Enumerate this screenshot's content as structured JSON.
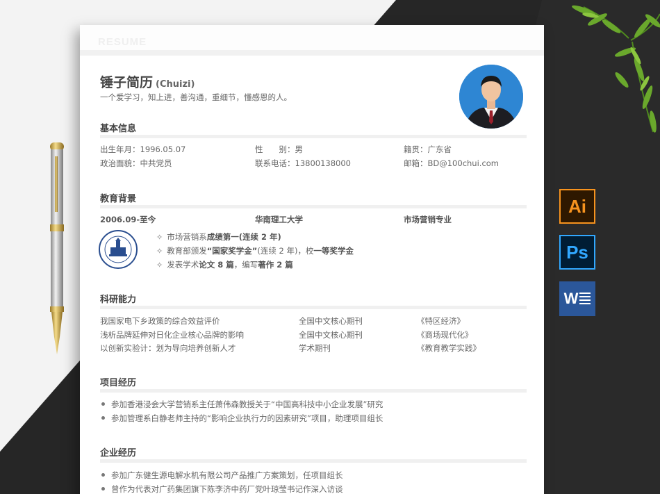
{
  "resume": {
    "watermark": "RESUME",
    "name": "锤子简历",
    "name_en": "(Chuizi)",
    "motto": "一个爱学习，知上进，善沟通，重细节，懂感恩的人。"
  },
  "basic": {
    "title": "基本信息",
    "birth": "出生年月：1996.05.07",
    "gender_label": "性　　别：",
    "gender_value": "男",
    "hometown": "籍贯：广东省",
    "political": "政治面貌：中共党员",
    "phone": "联系电话：13800138000",
    "email": "邮箱：BD@100chui.com"
  },
  "education": {
    "title": "教育背景",
    "period": "2006.09-至今",
    "school": "华南理工大学",
    "major": "市场营销专业",
    "items": [
      {
        "a": "市场营销系",
        "b": "成绩第一(连续 2 年)",
        "c": "",
        "d": "",
        "e": ""
      },
      {
        "a": "教育部颁发",
        "b": "“国家奖学金”",
        "c": "(连续 2 年)，校",
        "d": "一等奖学金",
        "e": ""
      },
      {
        "a": "发表学术",
        "b": "论文 8 篇",
        "c": "，编写",
        "d": "著作 2 篇",
        "e": ""
      }
    ]
  },
  "research": {
    "title": "科研能力",
    "rows": [
      {
        "topic": "我国家电下乡政策的综合效益评价",
        "level": "全国中文核心期刊",
        "journal": "《特区经济》"
      },
      {
        "topic": "浅析品牌延伸对日化企业核心品牌的影响",
        "level": "全国中文核心期刊",
        "journal": "《商场现代化》"
      },
      {
        "topic": "以创新实验计：划为导向培养创新人才",
        "level": "学术期刊",
        "journal": "《教育教学实践》"
      }
    ]
  },
  "projects": {
    "title": "项目经历",
    "items": [
      "参加香港浸会大学营销系主任萧伟森教授关于“中国高科技中小企业发展”研究",
      "参加管理系白静老师主持的“影响企业执行力的因素研究”项目，助理项目组长"
    ]
  },
  "enterprise": {
    "title": "企业经历",
    "items": [
      "参加广东健生源电解水机有限公司产品推广方案策划，任项目组长",
      "曾作为代表对广药集团旗下陈李济中药厂党叶琼莹书记作深入访谈"
    ]
  },
  "icons": {
    "ai": "Ai",
    "ps": "Ps",
    "word": "W"
  },
  "colors": {
    "avatar_bg": "#2e86d3",
    "ai_accent": "#f7931e",
    "ps_accent": "#31a8ff",
    "word_bg": "#2b579a"
  }
}
